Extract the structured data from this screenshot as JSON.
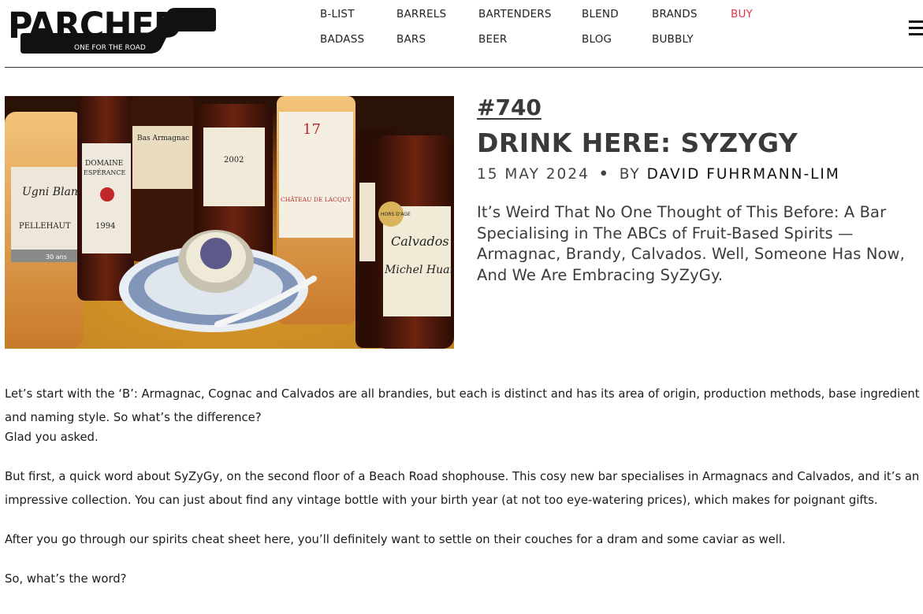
{
  "brand": {
    "name": "PARCHED",
    "tagline": "ONE FOR THE ROAD"
  },
  "nav": {
    "items": [
      {
        "label": "B-LIST"
      },
      {
        "label": "BARRELS"
      },
      {
        "label": "BARTENDERS"
      },
      {
        "label": "BLEND"
      },
      {
        "label": "BRANDS"
      },
      {
        "label": "BUY"
      },
      {
        "label": "BADASS"
      },
      {
        "label": "BARS"
      },
      {
        "label": "BEER"
      },
      {
        "label": "BLOG"
      },
      {
        "label": "BUBBLY"
      }
    ],
    "accent_color": "#e0344a",
    "menu_icon": "hamburger-menu-icon"
  },
  "article": {
    "number": "#740",
    "title": "DRINK HERE: SYZYGY",
    "date": "15 MAY 2024",
    "separator": "•",
    "by": "BY",
    "author": "DAVID FUHRMANN-LIM",
    "standfirst": "It’s Weird That No One Thought of This Before: A Bar Specialising in The ABCs of Fruit-Based Spirits — Armagnac, Brandy, Calvados. Well, Someone Has Now, And We Are Embracing SyZyGy.",
    "paragraphs": [
      "Let’s start with the ‘B’: Armagnac, Cognac and Calvados are all brandies, but each is distinct and has its area of origin, production methods, base ingredient and naming style. So what’s the difference?",
      "Glad you asked.",
      "But first, a quick word about SyZyGy, on the second floor of a Beach Road shophouse. This cosy new bar specialises in Armagnacs and Calvados, and it’s an impressive collection. You can just about find any vintage bottle with your birth year (at not too eye-watering prices), which makes for poignant gifts.",
      "After you go through our spirits cheat sheet here, you’ll definitely want to settle on their couches for a dram and some caviar as well.",
      "So, what’s the word?"
    ]
  },
  "hero_image": {
    "bottle_labels": [
      "Ugni Blanc",
      "PELLEHAUT",
      "30 ans",
      "DOMAINE",
      "ESPÉRANCE",
      "1994",
      "Bas Armagnac",
      "2002",
      "17",
      "CHÂTEAU DE LACQUY",
      "HORS D'AGE",
      "Calvados",
      "Michel Huard"
    ]
  }
}
